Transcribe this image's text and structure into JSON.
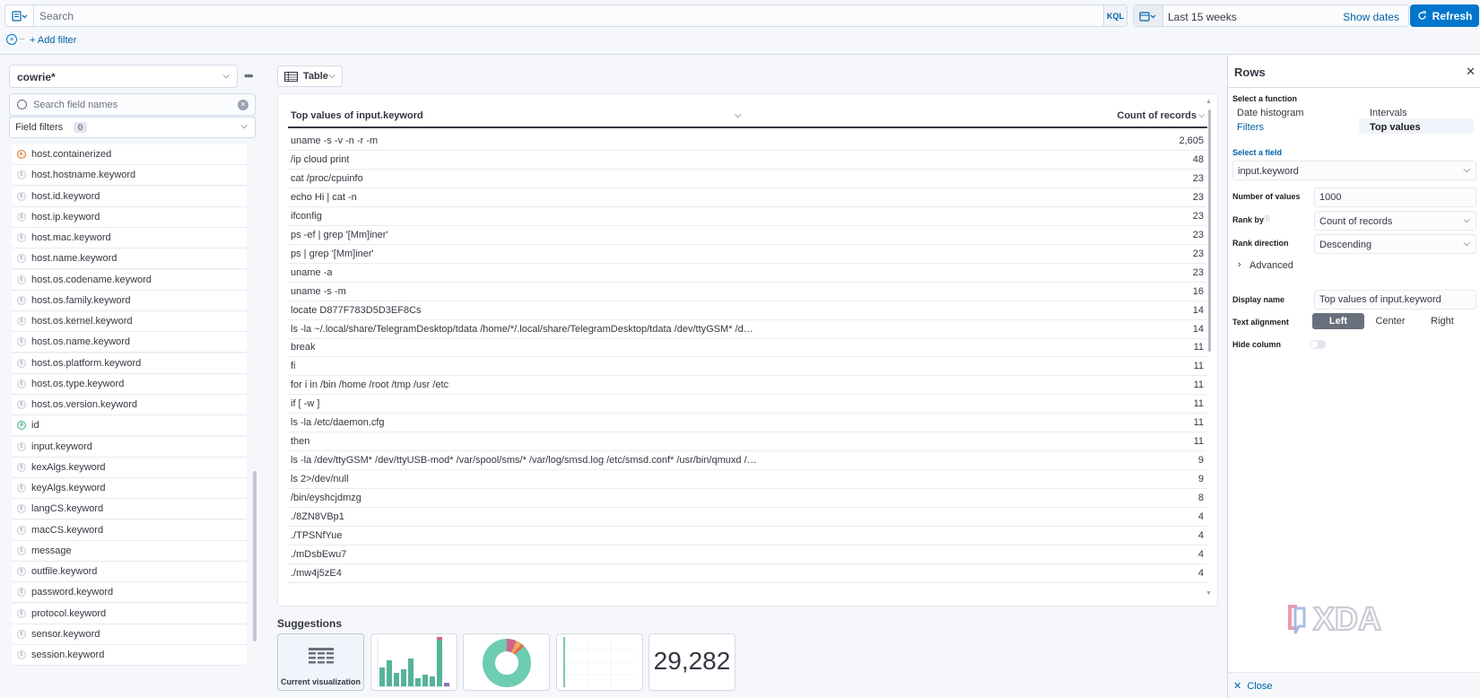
{
  "querybar": {
    "search_placeholder": "Search",
    "kql_label": "KQL",
    "date_label": "Last 15 weeks",
    "show_dates_label": "Show dates",
    "refresh_label": "Refresh",
    "add_filter_label": "+ Add filter"
  },
  "sidebar": {
    "index_pattern": "cowrie*",
    "field_search_placeholder": "Search field names",
    "field_filters_label": "Field filters",
    "field_filters_count": "0",
    "fields": [
      {
        "name": "host.containerized",
        "type": "bool"
      },
      {
        "name": "host.hostname.keyword",
        "type": "t"
      },
      {
        "name": "host.id.keyword",
        "type": "t"
      },
      {
        "name": "host.ip.keyword",
        "type": "t"
      },
      {
        "name": "host.mac.keyword",
        "type": "t"
      },
      {
        "name": "host.name.keyword",
        "type": "t"
      },
      {
        "name": "host.os.codename.keyword",
        "type": "t"
      },
      {
        "name": "host.os.family.keyword",
        "type": "t"
      },
      {
        "name": "host.os.kernel.keyword",
        "type": "t"
      },
      {
        "name": "host.os.name.keyword",
        "type": "t"
      },
      {
        "name": "host.os.platform.keyword",
        "type": "t"
      },
      {
        "name": "host.os.type.keyword",
        "type": "t"
      },
      {
        "name": "host.os.version.keyword",
        "type": "t"
      },
      {
        "name": "id",
        "type": "num"
      },
      {
        "name": "input.keyword",
        "type": "t"
      },
      {
        "name": "kexAlgs.keyword",
        "type": "t"
      },
      {
        "name": "keyAlgs.keyword",
        "type": "t"
      },
      {
        "name": "langCS.keyword",
        "type": "t"
      },
      {
        "name": "macCS.keyword",
        "type": "t"
      },
      {
        "name": "message",
        "type": "t"
      },
      {
        "name": "outfile.keyword",
        "type": "t"
      },
      {
        "name": "password.keyword",
        "type": "t"
      },
      {
        "name": "protocol.keyword",
        "type": "t"
      },
      {
        "name": "sensor.keyword",
        "type": "t"
      },
      {
        "name": "session.keyword",
        "type": "t"
      }
    ]
  },
  "workspace": {
    "chart_type_label": "Table",
    "table": {
      "col1_header": "Top values of input.keyword",
      "col2_header": "Count of records",
      "rows": [
        {
          "key": "uname -s -v -n -r -m",
          "count": "2,605"
        },
        {
          "key": "/ip cloud print",
          "count": "48"
        },
        {
          "key": "cat /proc/cpuinfo",
          "count": "23"
        },
        {
          "key": "echo Hi | cat -n",
          "count": "23"
        },
        {
          "key": "ifconfig",
          "count": "23"
        },
        {
          "key": "ps -ef | grep '[Mm]iner'",
          "count": "23"
        },
        {
          "key": "ps | grep '[Mm]iner'",
          "count": "23"
        },
        {
          "key": "uname -a",
          "count": "23"
        },
        {
          "key": "uname -s -m",
          "count": "16"
        },
        {
          "key": "locate D877F783D5D3EF8Cs",
          "count": "14"
        },
        {
          "key": "ls -la ~/.local/share/TelegramDesktop/tdata /home/*/.local/share/TelegramDesktop/tdata /dev/ttyGSM* /dev/ttyUSB...",
          "count": "14"
        },
        {
          "key": "break",
          "count": "11"
        },
        {
          "key": "fi",
          "count": "11"
        },
        {
          "key": "for i in /bin /home /root /tmp /usr /etc",
          "count": "11"
        },
        {
          "key": "if [ -w ]",
          "count": "11"
        },
        {
          "key": "ls -la /etc/daemon.cfg",
          "count": "11"
        },
        {
          "key": "then",
          "count": "11"
        },
        {
          "key": "ls -la /dev/ttyGSM* /dev/ttyUSB-mod* /var/spool/sms/* /var/log/smsd.log /etc/smsd.conf* /usr/bin/qmuxd /var/qmu...",
          "count": "9"
        },
        {
          "key": "ls 2>/dev/null",
          "count": "9"
        },
        {
          "key": "/bin/eyshcjdmzg",
          "count": "8"
        },
        {
          "key": "./8ZN8VBp1",
          "count": "4"
        },
        {
          "key": "./TPSNfYue",
          "count": "4"
        },
        {
          "key": "./mDsbEwu7",
          "count": "4"
        },
        {
          "key": "./mw4j5zE4",
          "count": "4"
        }
      ]
    },
    "suggestions_title": "Suggestions",
    "suggestions": {
      "current_label": "Current visualization",
      "metric_value": "29,282"
    }
  },
  "flyout": {
    "title": "Rows",
    "select_function_label": "Select a function",
    "functions": {
      "date_histogram": "Date histogram",
      "intervals": "Intervals",
      "filters": "Filters",
      "top_values": "Top values"
    },
    "select_field_label": "Select a field",
    "field_value": "input.keyword",
    "number_of_values_label": "Number of values",
    "number_of_values": "1000",
    "rank_by_label": "Rank by",
    "rank_by_value": "Count of records",
    "rank_direction_label": "Rank direction",
    "rank_direction_value": "Descending",
    "advanced_label": "Advanced",
    "display_name_label": "Display name",
    "display_name_value": "Top values of input.keyword",
    "text_alignment_label": "Text alignment",
    "align_left": "Left",
    "align_center": "Center",
    "align_right": "Right",
    "hide_column_label": "Hide column",
    "hide_column_on": false,
    "close_label": "Close"
  },
  "watermark": {
    "brand": "XDA"
  },
  "colors": {
    "primary": "#0077cc",
    "link": "#0061a6",
    "suggestion_green": "#54b399",
    "suggestion_pink": "#d36086"
  }
}
